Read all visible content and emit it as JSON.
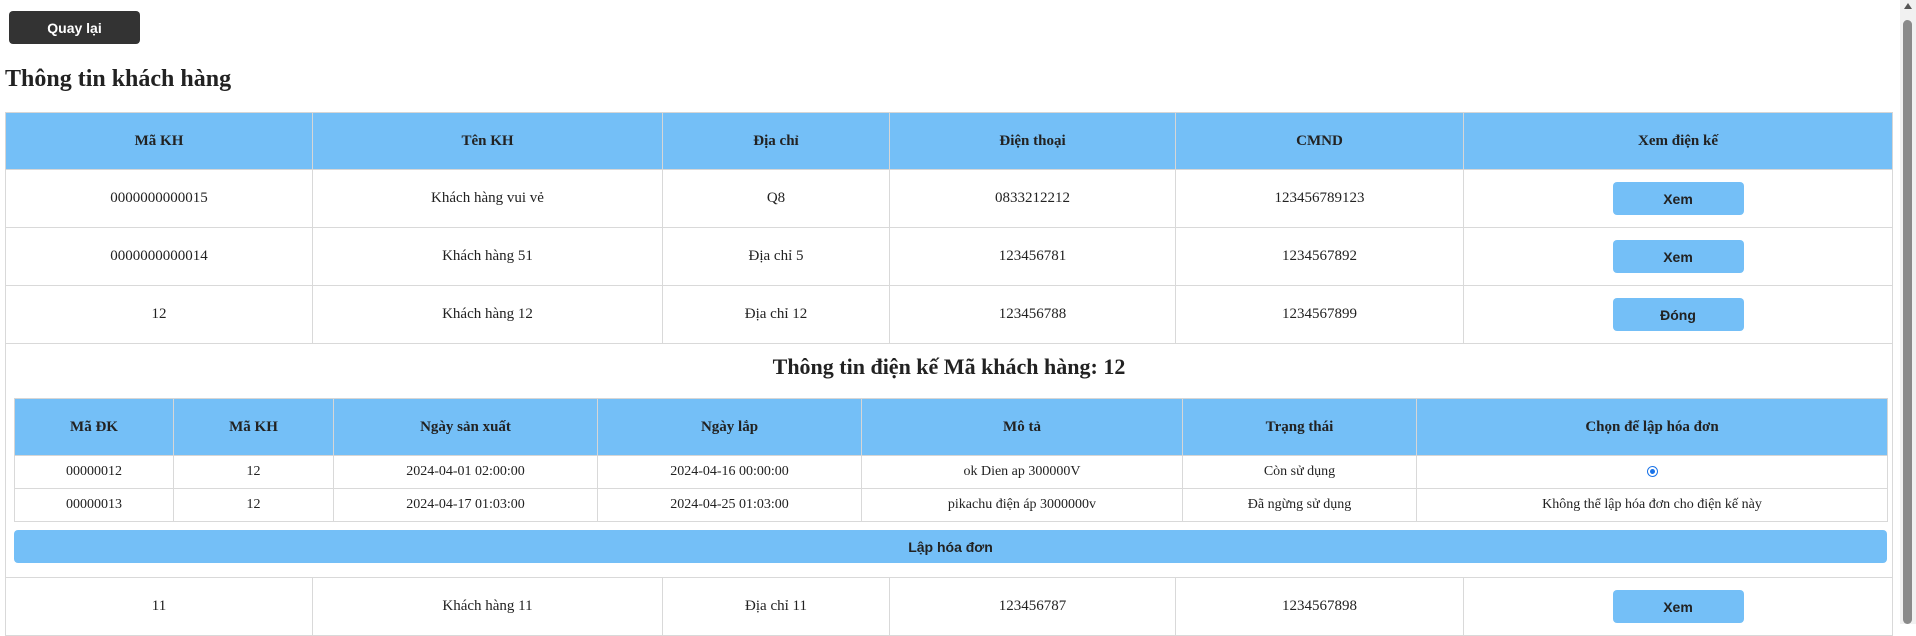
{
  "back_button": "Quay lại",
  "page_title": "Thông tin khách hàng",
  "customer_table": {
    "headers": [
      "Mã KH",
      "Tên KH",
      "Địa chỉ",
      "Điện thoại",
      "CMND",
      "Xem điện kế"
    ],
    "rows": [
      {
        "id": "0000000000015",
        "name": "Khách hàng vui vẻ",
        "address": "Q8",
        "phone": "0833212212",
        "cmnd": "123456789123",
        "action": "Xem"
      },
      {
        "id": "0000000000014",
        "name": "Khách hàng 51",
        "address": "Địa chỉ 5",
        "phone": "123456781",
        "cmnd": "1234567892",
        "action": "Xem"
      },
      {
        "id": "12",
        "name": "Khách hàng 12",
        "address": "Địa chỉ 12",
        "phone": "123456788",
        "cmnd": "1234567899",
        "action": "Đóng"
      },
      {
        "id": "11",
        "name": "Khách hàng 11",
        "address": "Địa chỉ 11",
        "phone": "123456787",
        "cmnd": "1234567898",
        "action": "Xem"
      }
    ]
  },
  "meter_detail": {
    "title": "Thông tin điện kế Mã khách hàng: 12",
    "headers": [
      "Mã ĐK",
      "Mã KH",
      "Ngày sản xuất",
      "Ngày lắp",
      "Mô tả",
      "Trạng thái",
      "Chọn để lập hóa đơn"
    ],
    "rows": [
      {
        "meter_id": "00000012",
        "customer_id": "12",
        "manufactured": "2024-04-01 02:00:00",
        "installed": "2024-04-16 00:00:00",
        "description": "ok Dien ap 300000V",
        "status": "Còn sử dụng",
        "select": "",
        "selected": true
      },
      {
        "meter_id": "00000013",
        "customer_id": "12",
        "manufactured": "2024-04-17 01:03:00",
        "installed": "2024-04-25 01:03:00",
        "description": "pikachu điện áp 3000000v",
        "status": "Đã ngừng sử dụng",
        "select": "Không thể lập hóa đơn cho điện kế này",
        "selected": false
      }
    ],
    "invoice_button": "Lập hóa đơn"
  },
  "colors": {
    "header_bg": "#74bff7",
    "back_button_bg": "#333333",
    "radio": "#1a73e8"
  }
}
